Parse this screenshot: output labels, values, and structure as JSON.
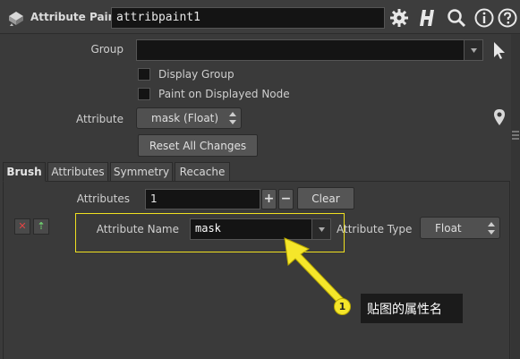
{
  "header": {
    "node_type": "Attribute Paint",
    "node_name": "attribpaint1"
  },
  "group": {
    "label": "Group",
    "value": "",
    "display_group_label": "Display Group",
    "paint_on_displayed_label": "Paint on Displayed Node"
  },
  "attribute": {
    "label": "Attribute",
    "selected": "mask (Float)",
    "reset_label": "Reset All Changes"
  },
  "tabs": [
    {
      "label": "Brush",
      "active": true
    },
    {
      "label": "Attributes",
      "active": false
    },
    {
      "label": "Symmetry",
      "active": false
    },
    {
      "label": "Recache",
      "active": false
    }
  ],
  "attributes_panel": {
    "count_label": "Attributes",
    "count_value": "1",
    "add_label": "+",
    "remove_label": "−",
    "clear_label": "Clear",
    "close_row_label": "✕",
    "move_row_label": "⇡",
    "name_label": "Attribute Name",
    "name_value": "mask",
    "type_label": "Attribute Type",
    "type_value": "Float"
  },
  "callout": {
    "badge": "1",
    "text": "贴图的属性名",
    "color": "#f5e62a"
  },
  "colors": {
    "background": "#3a3a3a",
    "field": "#141414",
    "highlight": "#f0e020"
  }
}
